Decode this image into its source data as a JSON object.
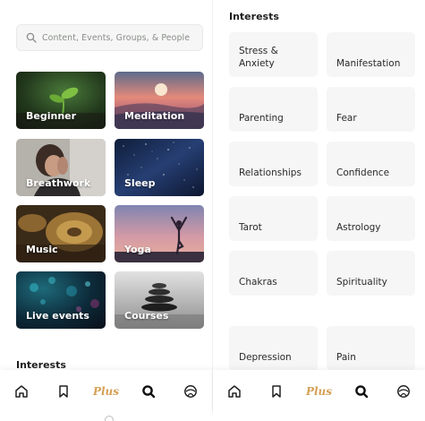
{
  "search": {
    "placeholder": "Content, Events, Groups, & People"
  },
  "categories": [
    {
      "label": "Beginner"
    },
    {
      "label": "Meditation"
    },
    {
      "label": "Breathwork"
    },
    {
      "label": "Sleep"
    },
    {
      "label": "Music"
    },
    {
      "label": "Yoga"
    },
    {
      "label": "Live events"
    },
    {
      "label": "Courses"
    }
  ],
  "left_section_title": "Interests",
  "nav": {
    "plus_label": "Plus"
  },
  "interests": {
    "title": "Interests",
    "items": [
      {
        "label": "Stress &\nAnxiety"
      },
      {
        "label": "Manifestation"
      },
      {
        "label": "Parenting"
      },
      {
        "label": "Fear"
      },
      {
        "label": "Relationships"
      },
      {
        "label": "Confidence"
      },
      {
        "label": "Tarot"
      },
      {
        "label": "Astrology"
      },
      {
        "label": "Chakras"
      },
      {
        "label": "Spirituality"
      },
      {
        "label": "Depression"
      },
      {
        "label": "Pain"
      }
    ]
  },
  "colors": {
    "accent_plus": "#d4a055",
    "card_bg": "#f5f6f5"
  }
}
